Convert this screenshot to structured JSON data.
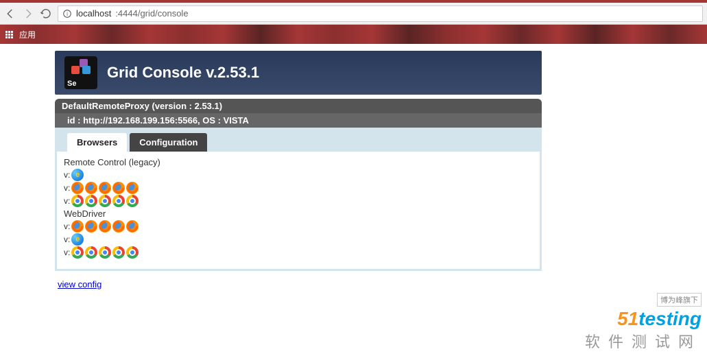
{
  "browser": {
    "url_host": "localhost",
    "url_port_path": ":4444/grid/console",
    "bookmarks_label": "应用"
  },
  "header": {
    "logo_text": "Se",
    "title": "Grid Console v.2.53.1"
  },
  "proxy": {
    "line1": "DefaultRemoteProxy (version : 2.53.1)",
    "line2": "id : http://192.168.199.156:5566, OS : VISTA"
  },
  "tabs": {
    "browsers": "Browsers",
    "configuration": "Configuration"
  },
  "panel": {
    "rc_title": "Remote Control (legacy)",
    "wd_title": "WebDriver",
    "v_label": "v:",
    "rc_rows": [
      {
        "icons": [
          "ie"
        ]
      },
      {
        "icons": [
          "ff",
          "ff",
          "ff",
          "ff",
          "ff"
        ]
      },
      {
        "icons": [
          "ch",
          "ch",
          "ch",
          "ch",
          "ch"
        ]
      }
    ],
    "wd_rows": [
      {
        "icons": [
          "ff",
          "ff",
          "ff",
          "ff",
          "ff"
        ]
      },
      {
        "icons": [
          "ie"
        ]
      },
      {
        "icons": [
          "ch",
          "ch",
          "ch",
          "ch",
          "ch"
        ]
      }
    ]
  },
  "links": {
    "view_config": "view config"
  },
  "watermark": {
    "top": "博为峰旗下",
    "main_51": "51",
    "main_rest": "testing",
    "sub": "软件测试网"
  }
}
